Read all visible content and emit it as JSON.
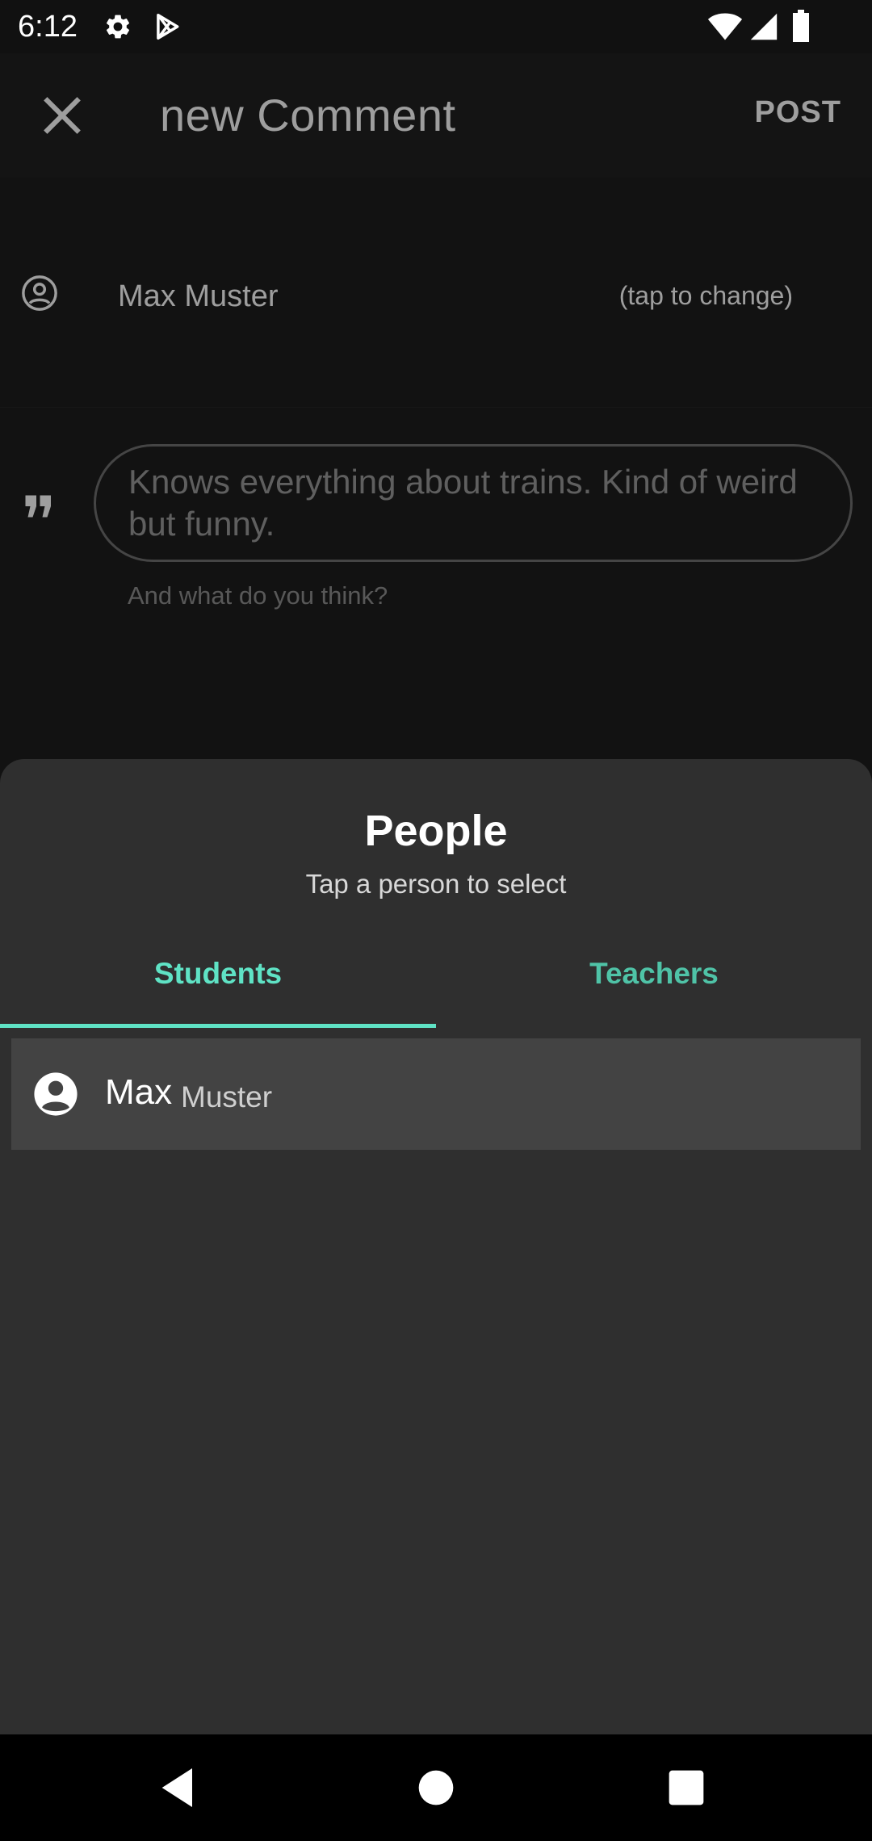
{
  "status_bar": {
    "time": "6:12",
    "icons": [
      "gear-icon",
      "play-store-icon",
      "wifi-icon",
      "signal-icon",
      "battery-icon"
    ]
  },
  "toolbar": {
    "close_icon": "close-icon",
    "title": "new Comment",
    "post_label": "POST"
  },
  "author": {
    "icon": "account-circle-icon",
    "name": "Max Muster",
    "hint": "(tap to change)"
  },
  "comment": {
    "icon": "quote-icon",
    "placeholder": "Knows everything about trains. Kind of weird but funny.",
    "helper": "And what do you think?"
  },
  "sheet": {
    "title": "People",
    "subtitle": "Tap a person to select",
    "tabs": [
      {
        "label": "Students",
        "selected": true
      },
      {
        "label": "Teachers",
        "selected": false
      }
    ],
    "people": [
      {
        "first": "Max",
        "last": "Muster",
        "icon": "account-circle-icon"
      }
    ]
  },
  "colors": {
    "accent": "#5fe3c5",
    "sheet_bg": "#2f2f2f",
    "row_bg": "#434343",
    "background": "#1d1d1d"
  },
  "nav_bar": {
    "icons": [
      "back-icon",
      "home-icon",
      "recents-icon"
    ]
  }
}
